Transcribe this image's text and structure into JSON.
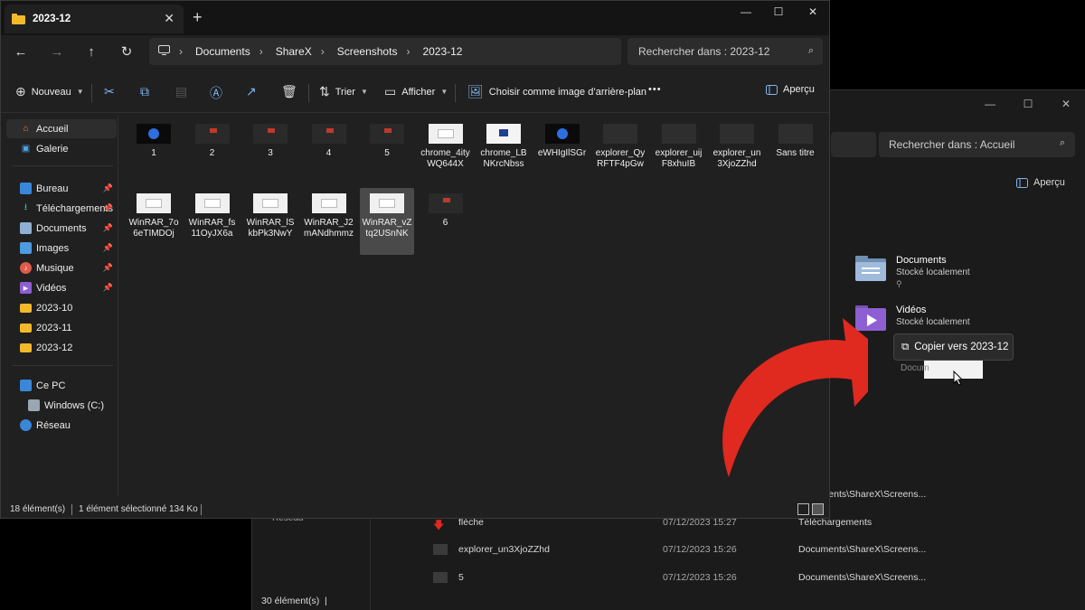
{
  "front": {
    "tab_title": "2023-12",
    "new_tab": "+",
    "breadcrumb": [
      "Documents",
      "ShareX",
      "Screenshots",
      "2023-12"
    ],
    "search_placeholder": "Rechercher dans : 2023-12",
    "toolbar": {
      "new": "Nouveau",
      "sort": "Trier",
      "view": "Afficher",
      "set_wallpaper": "Choisir comme image d’arrière-plan",
      "more": "•••",
      "preview": "Aperçu"
    },
    "sidebar": {
      "home": "Accueil",
      "gallery": "Galerie",
      "pinned": [
        {
          "label": "Bureau",
          "icon": "desktop-icon"
        },
        {
          "label": "Téléchargements",
          "icon": "download-icon"
        },
        {
          "label": "Documents",
          "icon": "documents-icon"
        },
        {
          "label": "Images",
          "icon": "images-icon"
        },
        {
          "label": "Musique",
          "icon": "music-icon"
        },
        {
          "label": "Vidéos",
          "icon": "videos-icon"
        }
      ],
      "folders": [
        "2023-10",
        "2023-11",
        "2023-12"
      ],
      "this_pc": "Ce PC",
      "drive": "Windows (C:)",
      "network": "Réseau"
    },
    "files_row1": [
      {
        "name": "1",
        "kind": "blue"
      },
      {
        "name": "2",
        "kind": "dark-red"
      },
      {
        "name": "3",
        "kind": "dark-red"
      },
      {
        "name": "4",
        "kind": "dark-red"
      },
      {
        "name": "5",
        "kind": "dark-red"
      },
      {
        "name": "chrome_4ityWQ644X",
        "kind": "white"
      },
      {
        "name": "chrome_LBNKrcNbss",
        "kind": "white-blue"
      },
      {
        "name": "eWHIgIlSGr",
        "kind": "blue"
      },
      {
        "name": "explorer_QyRFTF4pGw",
        "kind": "dark"
      },
      {
        "name": "explorer_uijF8xhuIB",
        "kind": "dark"
      },
      {
        "name": "explorer_un3XjoZZhd",
        "kind": "dark"
      },
      {
        "name": "Sans titre",
        "kind": "dark"
      }
    ],
    "files_row2": [
      {
        "name": "WinRAR_7o6eTIMDOj",
        "kind": "white"
      },
      {
        "name": "WinRAR_fs11OyJX6a",
        "kind": "white"
      },
      {
        "name": "WinRAR_lSkbPk3NwY",
        "kind": "white"
      },
      {
        "name": "WinRAR_J2mANdhmmz",
        "kind": "white"
      },
      {
        "name": "WinRAR_vZtq2USnNK",
        "kind": "white",
        "selected": true
      },
      {
        "name": "6",
        "kind": "dark-red"
      }
    ],
    "status": {
      "count": "18 élément(s)",
      "selected": "1 élément sélectionné",
      "size": "134 Ko"
    }
  },
  "back": {
    "search_placeholder": "Rechercher dans : Accueil",
    "preview": "Aperçu",
    "cards": [
      {
        "title": "Documents",
        "sub": "Stocké localement",
        "pin": "📌"
      },
      {
        "title": "Vidéos",
        "sub": "Stocké localement"
      }
    ],
    "reseau": "Réseau",
    "recent": [
      {
        "name": "",
        "date": "",
        "path": "Documents\\ShareX\\Screens..."
      },
      {
        "name": "flèche",
        "date": "07/12/2023 15:27",
        "path": "Téléchargements"
      },
      {
        "name": "explorer_un3XjoZZhd",
        "date": "07/12/2023 15:26",
        "path": "Documents\\ShareX\\Screens..."
      },
      {
        "name": "5",
        "date": "07/12/2023 15:26",
        "path": "Documents\\ShareX\\Screens..."
      }
    ],
    "status": "30 élément(s)"
  },
  "drag": {
    "tooltip": "Copier vers 2023-12",
    "behind_text": "Docum"
  },
  "colors": {
    "arrow": "#e0291f",
    "folder": "#f3b92b",
    "accent": "#7fb4f0"
  }
}
